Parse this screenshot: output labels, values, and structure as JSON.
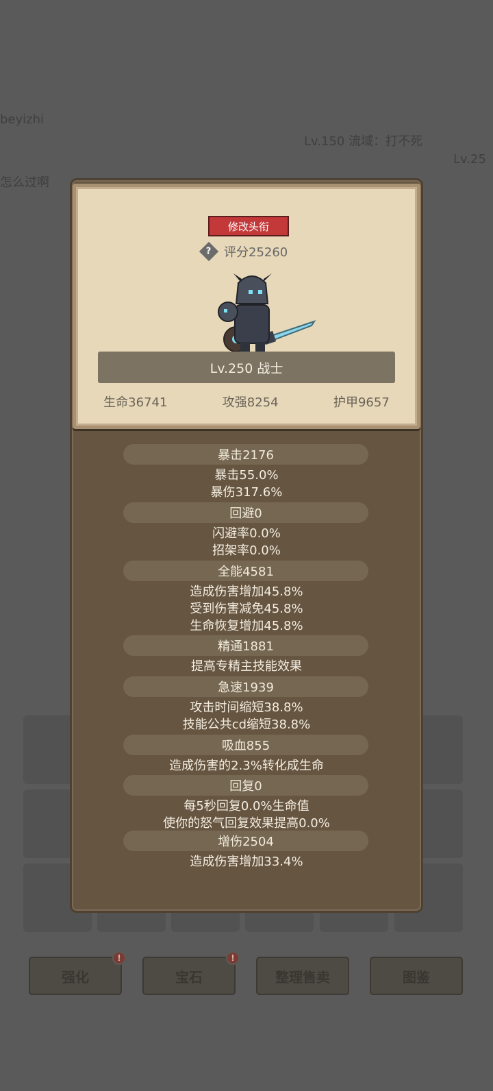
{
  "background": {
    "player_name": "beyizhi",
    "ranking_line": "Lv.150 流域：打不死",
    "level_right": "Lv.25",
    "chat_line": "怎么过啊",
    "buttons": [
      {
        "label": "强化",
        "badge": "!"
      },
      {
        "label": "宝石",
        "badge": "!"
      },
      {
        "label": "整理售卖",
        "badge": ""
      },
      {
        "label": "图鉴",
        "badge": ""
      }
    ]
  },
  "card": {
    "title_button": "修改头衔",
    "help_icon": "?",
    "score": "评分25260",
    "level_class": "Lv.250 战士",
    "stats": {
      "hp": "生命36741",
      "attack": "攻强8254",
      "armor": "护甲9657"
    }
  },
  "sections": [
    {
      "header": "暴击2176",
      "lines": [
        "暴击55.0%",
        "暴伤317.6%"
      ]
    },
    {
      "header": "回避0",
      "lines": [
        "闪避率0.0%",
        "招架率0.0%"
      ]
    },
    {
      "header": "全能4581",
      "lines": [
        "造成伤害增加45.8%",
        "受到伤害减免45.8%",
        "生命恢复增加45.8%"
      ]
    },
    {
      "header": "精通1881",
      "lines": [
        "提高专精主技能效果"
      ]
    },
    {
      "header": "急速1939",
      "lines": [
        "攻击时间缩短38.8%",
        "技能公共cd缩短38.8%"
      ]
    },
    {
      "header": "吸血855",
      "lines": [
        "造成伤害的2.3%转化成生命"
      ]
    },
    {
      "header": "回复0",
      "lines": [
        "每5秒回复0.0%生命值",
        "使你的怒气回复效果提高0.0%"
      ]
    },
    {
      "header": "增伤2504",
      "lines": [
        "造成伤害增加33.4%"
      ]
    }
  ]
}
